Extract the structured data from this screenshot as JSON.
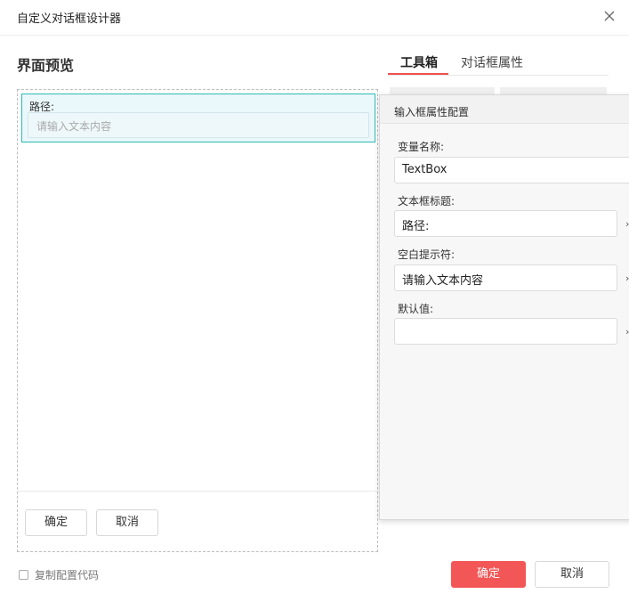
{
  "window": {
    "title": "自定义对话框设计器"
  },
  "preview": {
    "section_title": "界面预览",
    "field_label": "路径:",
    "field_placeholder": "请输入文本内容",
    "ok_label": "确定",
    "cancel_label": "取消"
  },
  "tabs": [
    {
      "label": "工具箱",
      "active": true
    },
    {
      "label": "对话框属性",
      "active": false
    }
  ],
  "properties": {
    "header": "输入框属性配置",
    "variable_name_label": "变量名称:",
    "variable_name_value": "TextBox",
    "title_label": "文本框标题:",
    "title_value": "路径:",
    "placeholder_label": "空白提示符:",
    "placeholder_value": "请输入文本内容",
    "default_label": "默认值:",
    "default_value": ""
  },
  "footer": {
    "copy_config_label": "复制配置代码",
    "ok_label": "确定",
    "cancel_label": "取消"
  },
  "colors": {
    "accent": "#f25656",
    "selection": "#2cbcb2",
    "selection_bg": "#eaf7fb"
  },
  "icons": [
    "close-icon",
    "checkbox-icon",
    "chevron-right-icon"
  ]
}
